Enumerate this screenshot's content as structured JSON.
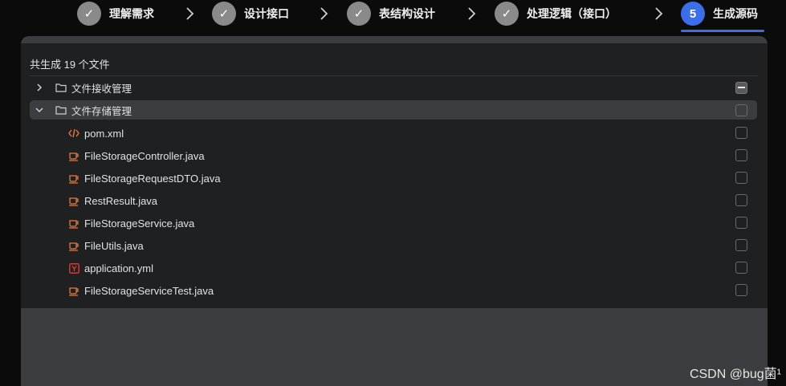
{
  "stepper": {
    "steps": [
      {
        "label": "理解需求",
        "mark": "✓"
      },
      {
        "label": "设计接口",
        "mark": "✓"
      },
      {
        "label": "表结构设计",
        "mark": "✓"
      },
      {
        "label": "处理逻辑（接口）",
        "mark": "✓"
      },
      {
        "label": "生成源码",
        "mark": "5"
      }
    ],
    "active_step": 5,
    "colors": {
      "done": "#8a8a8a",
      "active": "#3b6ee8"
    }
  },
  "panel": {
    "summary": "共生成 19 个文件",
    "folders": [
      {
        "name": "文件接收管理",
        "expanded": false,
        "checkbox": "indeterminate",
        "icon": "folder-icon"
      },
      {
        "name": "文件存储管理",
        "expanded": true,
        "checkbox": "unchecked",
        "icon": "folder-icon"
      }
    ],
    "files": [
      {
        "name": "pom.xml",
        "icon": "xml-icon"
      },
      {
        "name": "FileStorageController.java",
        "icon": "java-icon"
      },
      {
        "name": "FileStorageRequestDTO.java",
        "icon": "java-icon"
      },
      {
        "name": "RestResult.java",
        "icon": "java-icon"
      },
      {
        "name": "FileStorageService.java",
        "icon": "java-icon"
      },
      {
        "name": "FileUtils.java",
        "icon": "java-icon"
      },
      {
        "name": "application.yml",
        "icon": "yaml-icon"
      },
      {
        "name": "FileStorageServiceTest.java",
        "icon": "java-icon"
      }
    ]
  },
  "watermark": "CSDN @bug菌¹"
}
